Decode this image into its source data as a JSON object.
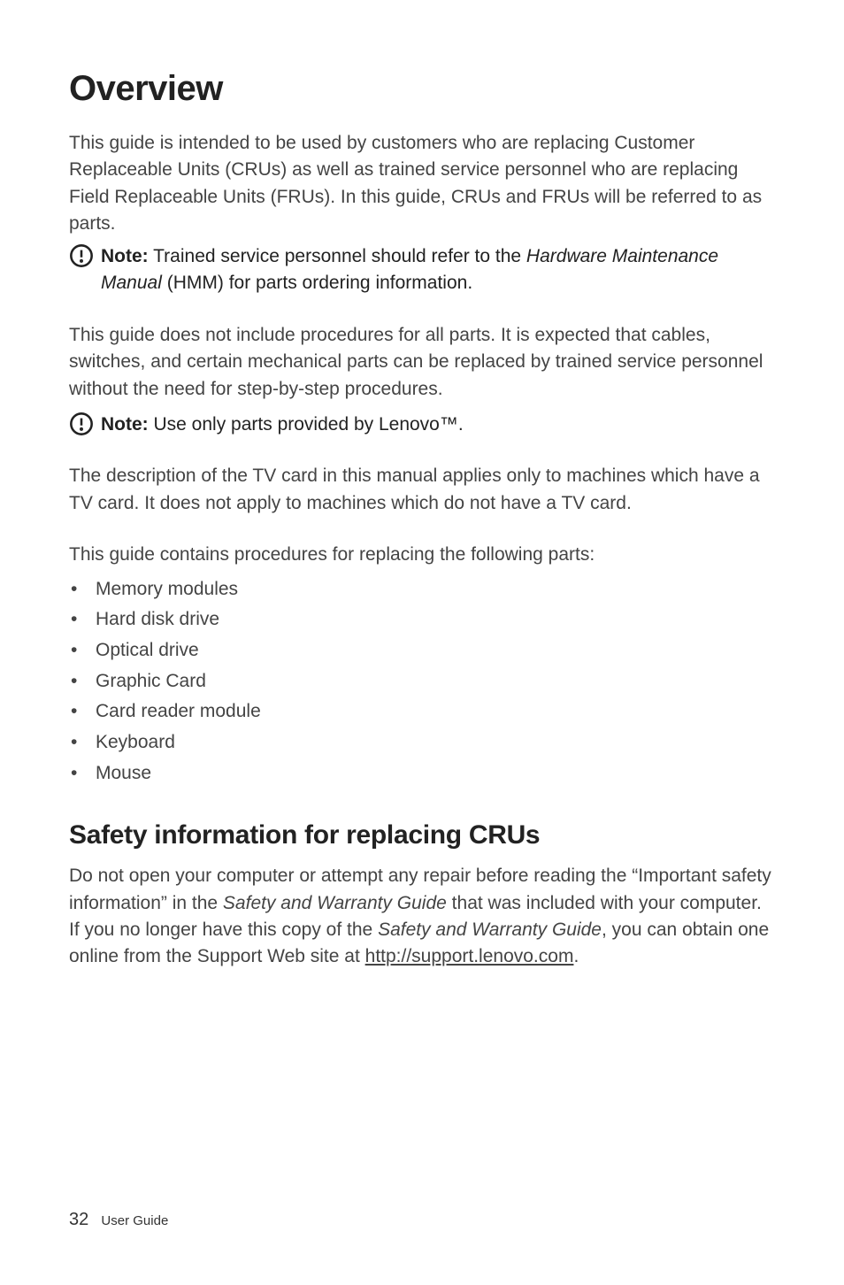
{
  "heading": "Overview",
  "intro": "This guide is intended to be used by customers who are replacing Customer Replaceable Units (CRUs) as well as trained service personnel who are replacing Field Replaceable Units (FRUs). In this guide, CRUs and FRUs will be referred to as parts.",
  "note1": {
    "prefix": "Note:",
    "line1_before": " Trained service personnel should refer to the ",
    "line1_italic": "Hardware Maintenance Manual",
    "line2_after": " (HMM) for parts ordering information."
  },
  "para2": "This guide does not include procedures for all parts. It is expected that cables, switches, and certain mechanical parts can be replaced by trained service personnel without the need for step-by-step procedures.",
  "note2": {
    "prefix": "Note:",
    "text": " Use only parts provided by Lenovo™."
  },
  "para3": "The description of the TV card in this manual applies only to machines which have a TV card. It does not apply to machines which do not have a TV card.",
  "list_intro": "This guide contains procedures for replacing the following parts:",
  "list": [
    "Memory modules",
    "Hard disk drive",
    "Optical drive",
    "Graphic Card",
    "Card reader module",
    "Keyboard",
    "Mouse"
  ],
  "subheading": "Safety information for replacing CRUs",
  "safety_para": {
    "t1": "Do not open your computer or attempt any repair before reading the “Important safety information” in the ",
    "i1": "Safety and Warranty Guide",
    "t2": " that was included with your computer. If you no longer have this copy of the ",
    "i2": "Safety and Warranty Guide",
    "t3": ", you can obtain one online from the Support Web site at ",
    "link": "http://support.lenovo.com",
    "t4": "."
  },
  "footer": {
    "page": "32",
    "label": "User Guide"
  }
}
